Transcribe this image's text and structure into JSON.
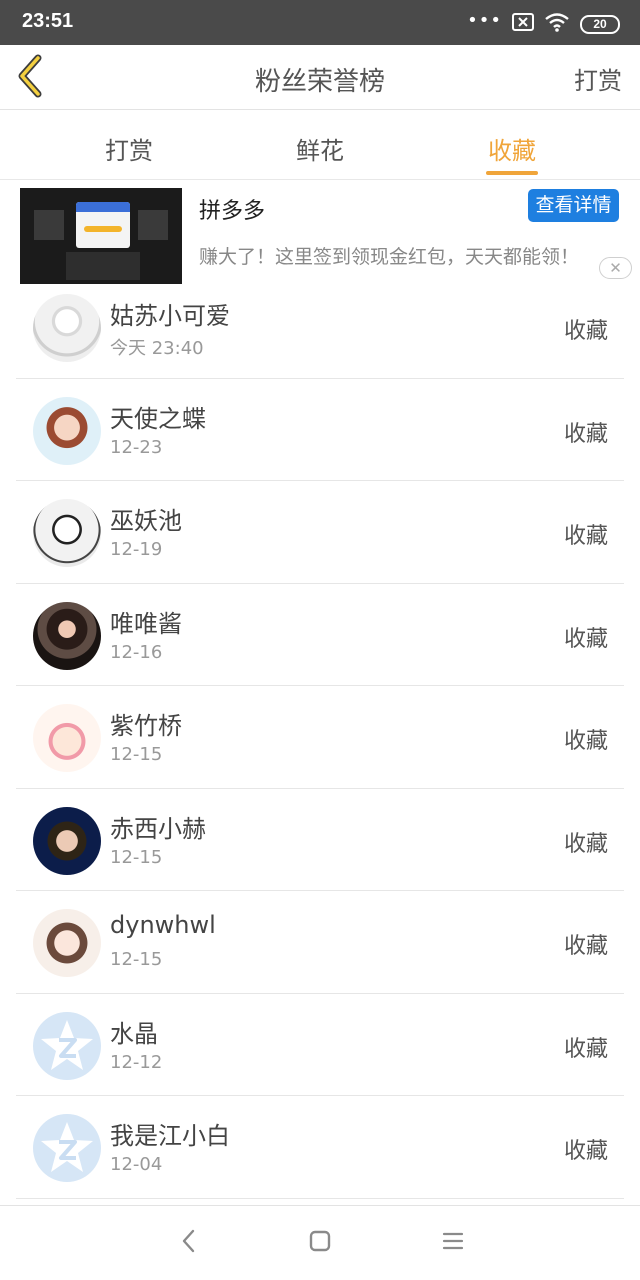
{
  "status_bar": {
    "time": "23:51",
    "dots": "•••",
    "battery": "20",
    "icons": [
      "close-box-icon",
      "wifi-icon"
    ]
  },
  "nav": {
    "title": "粉丝荣誉榜",
    "right_action": "打赏",
    "back_icon": "chevron-left-icon"
  },
  "tabs": [
    {
      "label": "打赏",
      "active": false
    },
    {
      "label": "鲜花",
      "active": false
    },
    {
      "label": "收藏",
      "active": true
    }
  ],
  "ad": {
    "title": "拼多多",
    "button": "查看详情",
    "description": "赚大了！这里签到领现金红包，天天都能领！",
    "close": "✕"
  },
  "list": [
    {
      "name": "姑苏小可爱",
      "date": "今天 23:40",
      "action": "收藏"
    },
    {
      "name": "天使之蝶",
      "date": "12-23",
      "action": "收藏"
    },
    {
      "name": "巫妖池",
      "date": "12-19",
      "action": "收藏"
    },
    {
      "name": "唯唯酱",
      "date": "12-16",
      "action": "收藏"
    },
    {
      "name": "紫竹桥",
      "date": "12-15",
      "action": "收藏"
    },
    {
      "name": "赤西小赫",
      "date": "12-15",
      "action": "收藏"
    },
    {
      "name": "dynwhwl",
      "date": "12-15",
      "action": "收藏"
    },
    {
      "name": "水晶",
      "date": "12-12",
      "action": "收藏"
    },
    {
      "name": "我是江小白",
      "date": "12-04",
      "action": "收藏"
    }
  ],
  "colors": {
    "accent": "#f0a53a",
    "ad_button": "#1e7fe0",
    "status_bar": "#4a4a4a"
  }
}
